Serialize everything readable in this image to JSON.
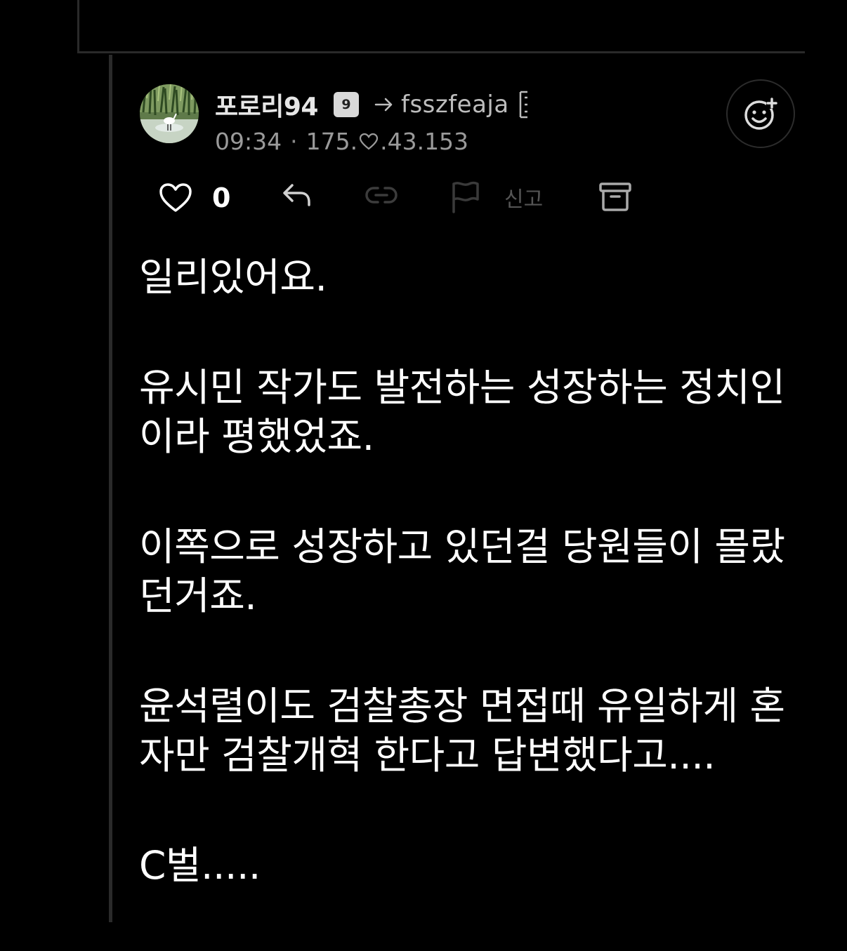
{
  "comment": {
    "author": "포로리94",
    "level": "9",
    "reply_target": "fsszfeaja",
    "time": "09:34",
    "ip_prefix": "175.",
    "ip_suffix": ".43.153",
    "like_count": "0",
    "report_label": "신고",
    "paragraphs": [
      "일리있어요.",
      "유시민 작가도 발전하는 성장하는 정치인이라 평했었죠.",
      "이쪽으로 성장하고 있던걸 당원들이 몰랐던거죠.",
      "윤석렬이도 검찰총장 면접때 유일하게 혼자만 검찰개혁 한다고 답변했다고....",
      "C벌....."
    ]
  },
  "colors": {
    "background": "#000000",
    "text": "#ffffff",
    "muted": "#9a9a9a",
    "divider": "#2a2a2a"
  },
  "icons": [
    "heart-icon",
    "reply-icon",
    "link-icon",
    "flag-icon",
    "archive-icon",
    "add-emoji-icon",
    "arrow-right-icon"
  ]
}
